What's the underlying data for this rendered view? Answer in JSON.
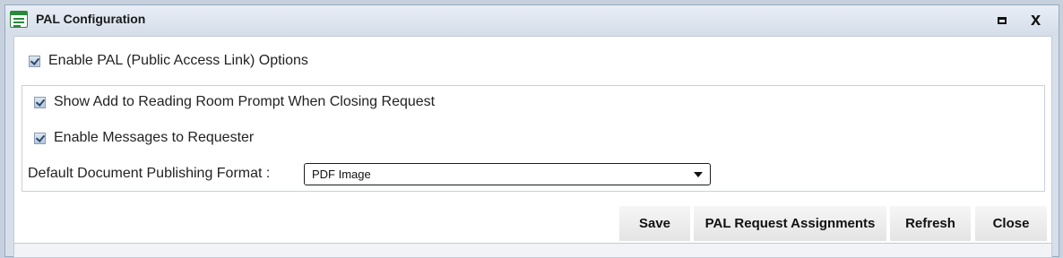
{
  "window": {
    "title": "PAL Configuration",
    "app_icon": "form-icon",
    "maximize_icon": "maximize-icon",
    "close_icon": "close-icon",
    "close_glyph": "x"
  },
  "options": {
    "enable_pal": {
      "label": "Enable PAL (Public Access Link) Options",
      "checked": true
    },
    "show_reading_room": {
      "label": "Show Add to Reading Room Prompt When Closing Request",
      "checked": true
    },
    "enable_messages": {
      "label": "Enable Messages to Requester",
      "checked": true
    },
    "publishing_format": {
      "label": "Default Document Publishing Format :",
      "value": "PDF Image"
    }
  },
  "buttons": {
    "save": "Save",
    "pal_request_assignments": "PAL Request Assignments",
    "refresh": "Refresh",
    "close": "Close"
  }
}
